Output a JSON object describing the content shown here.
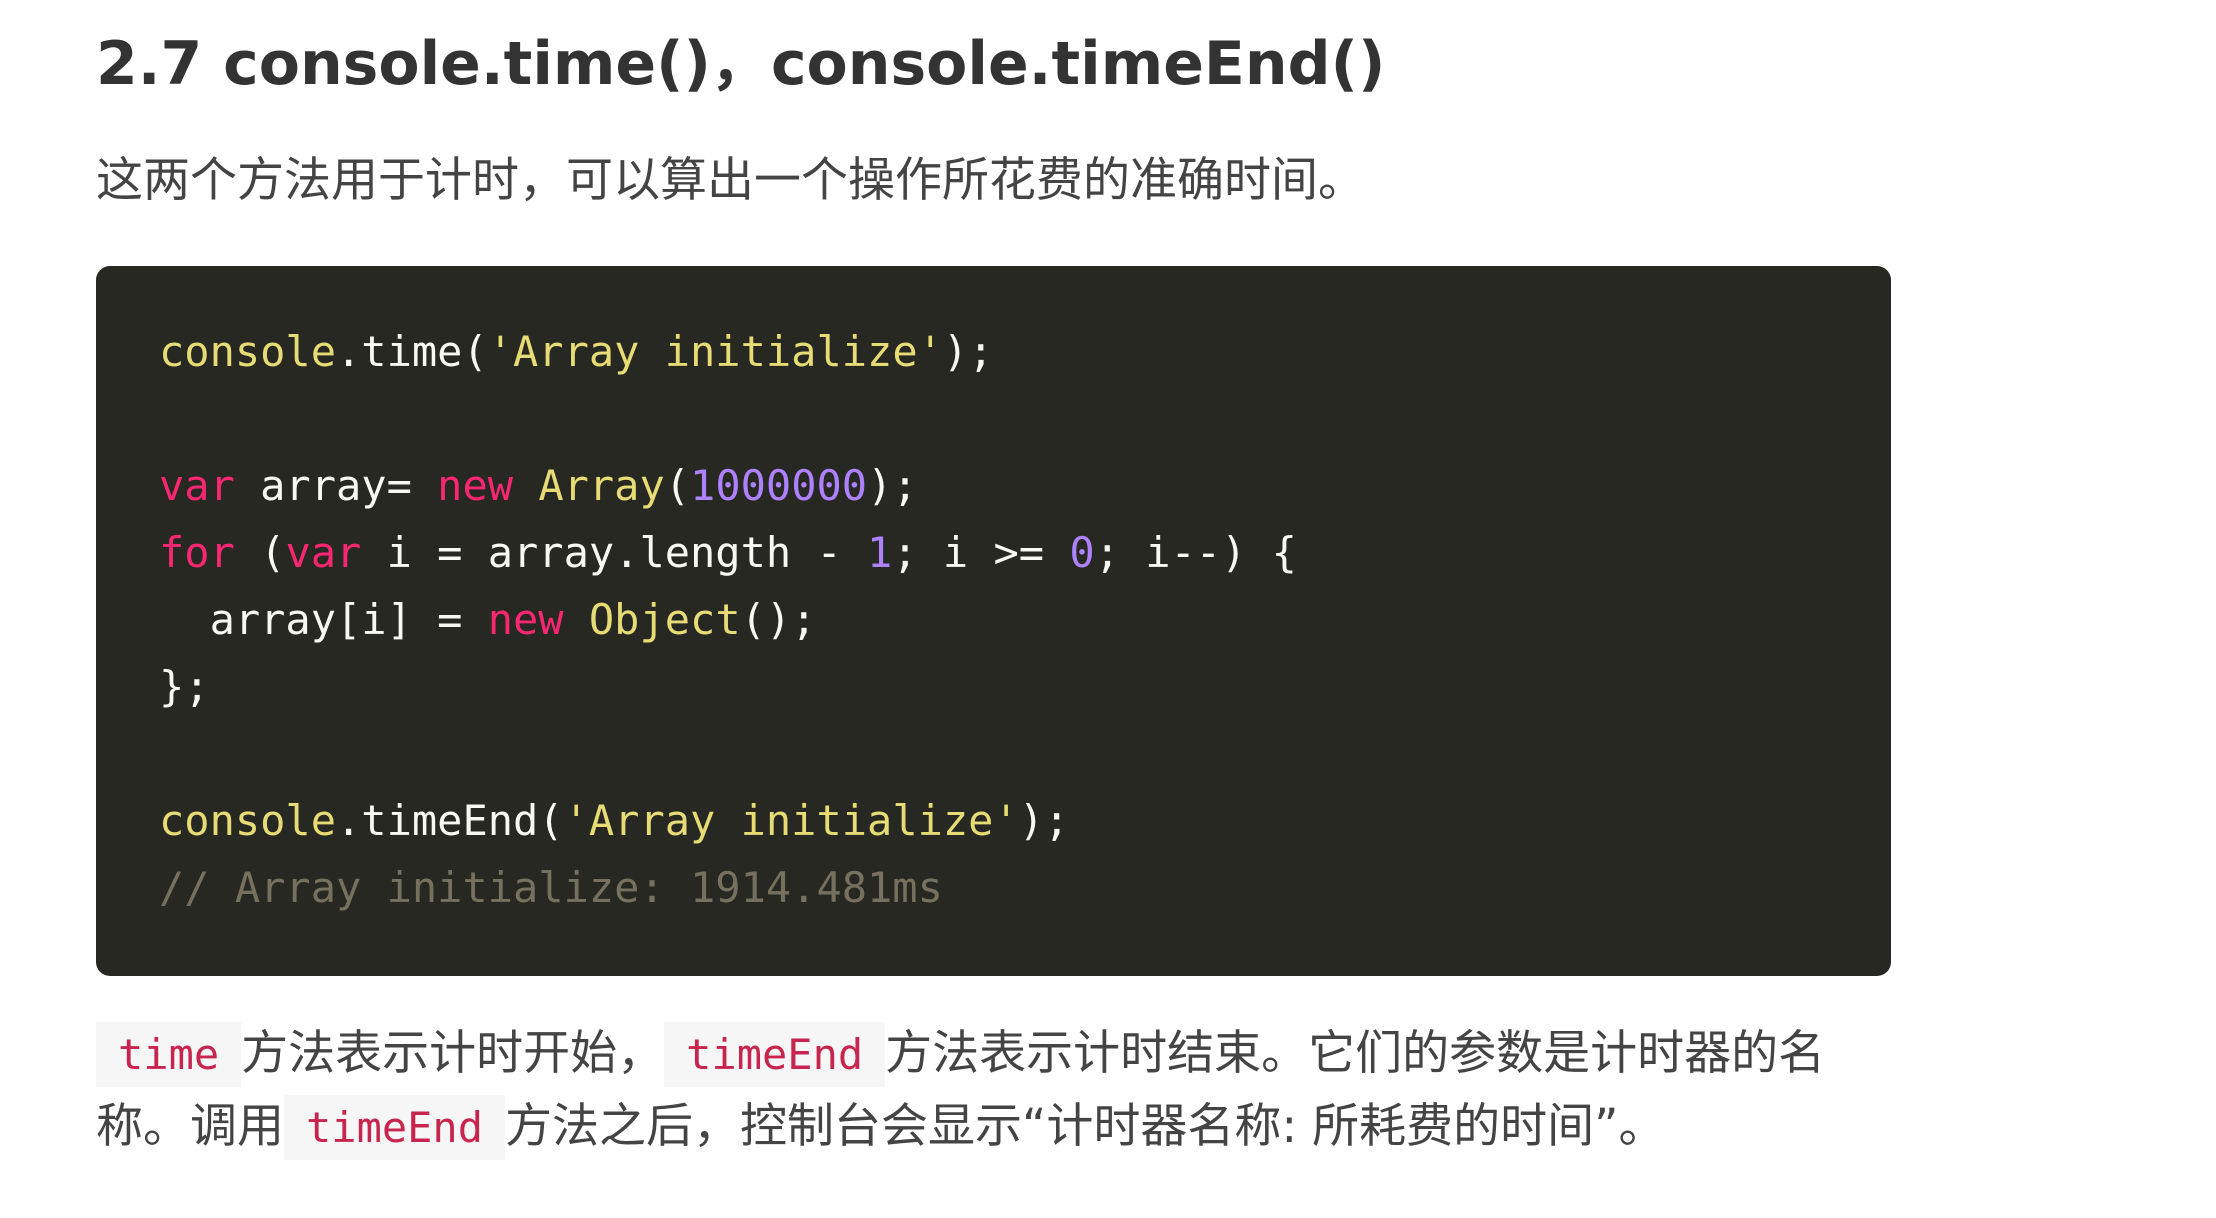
{
  "heading": "2.7 console.time()，console.timeEnd()",
  "intro": "这两个方法用于计时，可以算出一个操作所花费的准确时间。",
  "code": {
    "line1": {
      "t1": "console",
      "t2": ".time(",
      "t3": "'Array initialize'",
      "t4": ");"
    },
    "line2": {
      "t1": "var",
      "t2": " array= ",
      "t3": "new",
      "t4": " ",
      "t5": "Array",
      "t6": "(",
      "t7": "1000000",
      "t8": ");"
    },
    "line3": {
      "t1": "for",
      "t2": " (",
      "t3": "var",
      "t4": " i = array.length - ",
      "t5": "1",
      "t6": "; i >= ",
      "t7": "0",
      "t8": "; i--) {"
    },
    "line4": {
      "t1": "  array[i] = ",
      "t2": "new",
      "t3": " ",
      "t4": "Object",
      "t5": "();"
    },
    "line5": {
      "t1": "};"
    },
    "line6": {
      "t1": "console",
      "t2": ".timeEnd(",
      "t3": "'Array initialize'",
      "t4": ");"
    },
    "line7": {
      "t1": "// Array initialize: 1914.481ms"
    }
  },
  "paragraph": {
    "code1": "time",
    "text1": "方法表示计时开始，",
    "code2": "timeEnd",
    "text2": "方法表示计时结束。它们的参数是计时器的名称。调用",
    "code3": "timeEnd",
    "text3": "方法之后，控制台会显示“计时器名称: 所耗费的时间”。"
  },
  "colors": {
    "code_background": "#272822",
    "keyword": "#f92672",
    "string": "#e6db74",
    "number": "#ae81ff",
    "comment": "#75715e",
    "inline_code": "#c7254e"
  }
}
